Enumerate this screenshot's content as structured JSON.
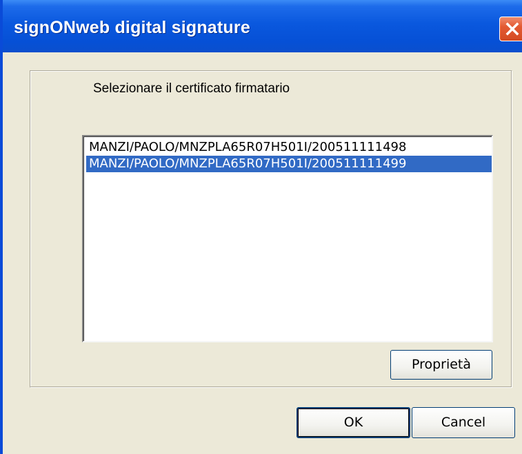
{
  "window": {
    "title": "signONweb digital signature"
  },
  "dialog": {
    "prompt": "Selezionare il certificato firmatario",
    "certificates": [
      {
        "label": "MANZI/PAOLO/MNZPLA65R07H501I/200511111498",
        "selected": false
      },
      {
        "label": "MANZI/PAOLO/MNZPLA65R07H501I/200511111499",
        "selected": true
      }
    ],
    "properties_label": "Proprietà"
  },
  "buttons": {
    "ok_label": "OK",
    "cancel_label": "Cancel"
  },
  "colors": {
    "titlebar": "#0a58de",
    "selection": "#316ac5",
    "close_button": "#e35a33",
    "dialog_bg": "#ece9d8"
  },
  "icons": {
    "close": "close-icon"
  }
}
